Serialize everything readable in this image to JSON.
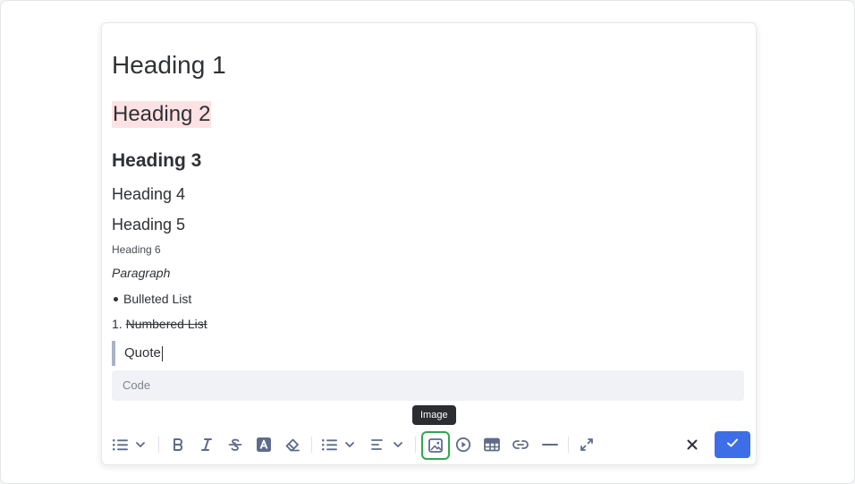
{
  "editor": {
    "heading1": "Heading 1",
    "heading2": "Heading 2",
    "heading3": "Heading 3",
    "heading4": "Heading 4",
    "heading5": "Heading 5",
    "heading6": "Heading 6",
    "paragraph": "Paragraph",
    "bulleted_list": "Bulleted List",
    "numbered_list_marker": "1.",
    "numbered_list": "Numbered List",
    "quote": "Quote",
    "code_placeholder": "Code"
  },
  "toolbar": {
    "tooltip": "Image",
    "icons": [
      "block-type-icon",
      "bold-icon",
      "italic-icon",
      "strikethrough-icon",
      "text-color-icon",
      "eraser-icon",
      "list-icon",
      "align-icon",
      "image-icon",
      "video-icon",
      "table-icon",
      "link-icon",
      "divider-icon",
      "expand-icon",
      "close-icon",
      "check-icon"
    ]
  },
  "colors": {
    "accent": "#3d6ee8",
    "highlight": "#fde2e4",
    "active_outline": "#2fa84f",
    "icon": "#5f6b8a"
  }
}
